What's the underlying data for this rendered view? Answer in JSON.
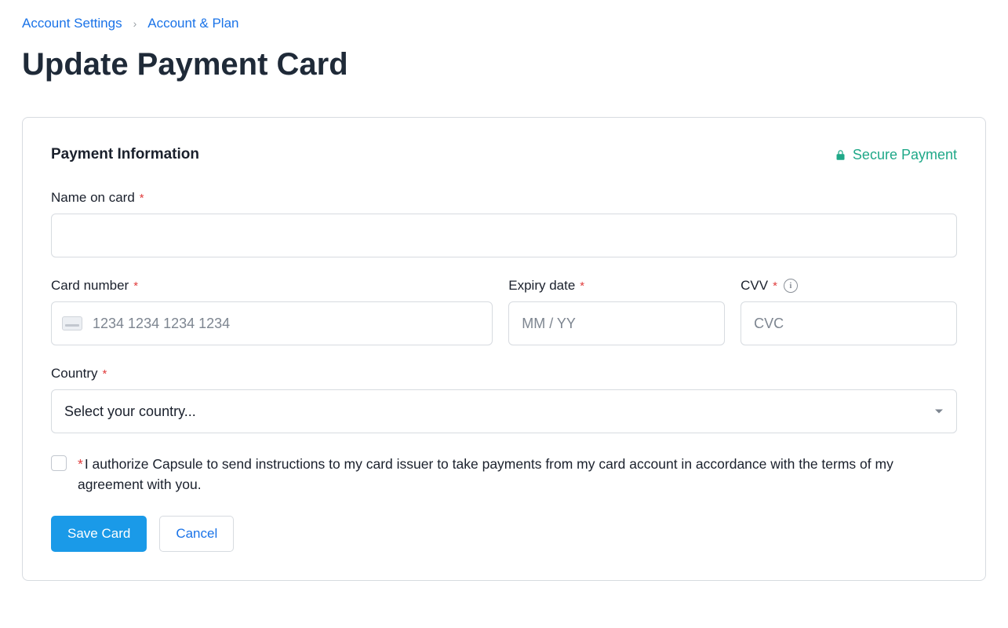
{
  "breadcrumb": {
    "item1": "Account Settings",
    "item2": "Account & Plan"
  },
  "page_title": "Update Payment Card",
  "section_title": "Payment Information",
  "secure_label": "Secure Payment",
  "fields": {
    "name_on_card": {
      "label": "Name on card",
      "value": ""
    },
    "card_number": {
      "label": "Card number",
      "placeholder": "1234 1234 1234 1234",
      "value": ""
    },
    "expiry": {
      "label": "Expiry date",
      "placeholder": "MM / YY",
      "value": ""
    },
    "cvv": {
      "label": "CVV",
      "placeholder": "CVC",
      "value": ""
    },
    "country": {
      "label": "Country",
      "placeholder": "Select your country..."
    }
  },
  "consent_text": "I authorize Capsule to send instructions to my card issuer to take payments from my card account in accordance with the terms of my agreement with you.",
  "actions": {
    "save": "Save Card",
    "cancel": "Cancel"
  }
}
